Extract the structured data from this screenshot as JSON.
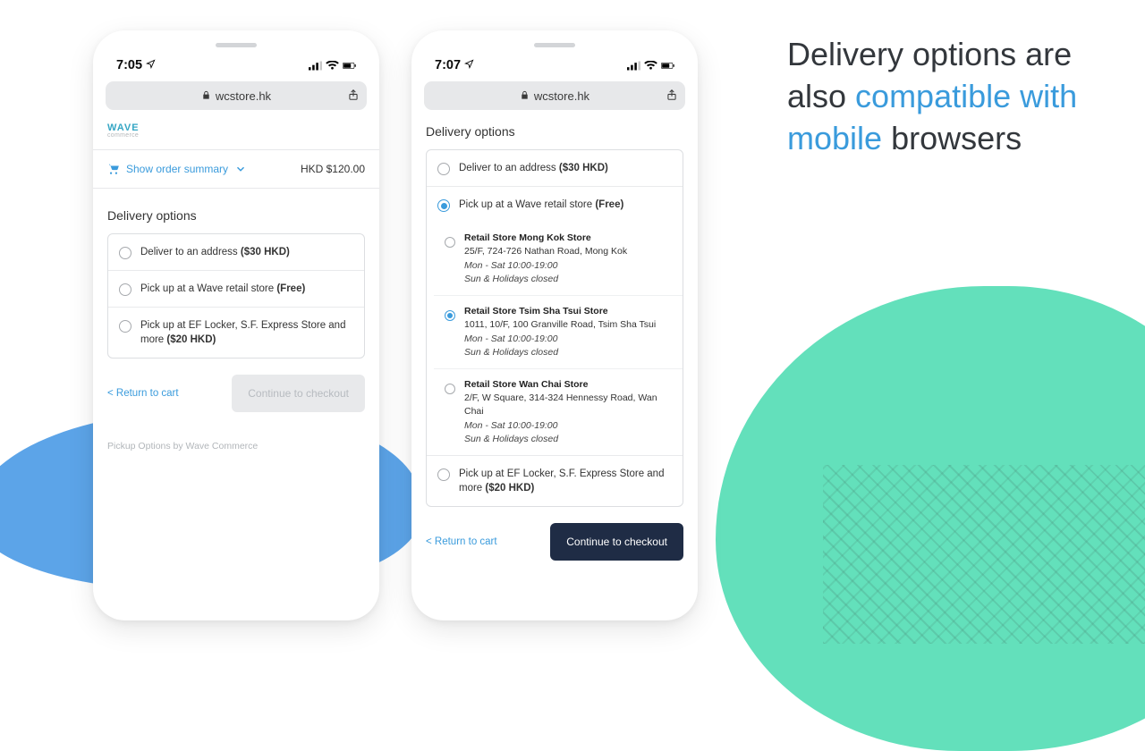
{
  "heading": {
    "part1": "Delivery options are also ",
    "highlight": "compatible with mobile",
    "part2": " browsers"
  },
  "phones": {
    "left": {
      "time": "7:05",
      "url": "wcstore.hk",
      "logo": "WAVE",
      "logo_sub": "commerce",
      "summary_label": "Show order summary",
      "summary_total": "HKD $120.00",
      "section_title": "Delivery options",
      "options": [
        {
          "label": "Deliver to an address ",
          "price": "($30 HKD)"
        },
        {
          "label": "Pick up at a Wave retail store ",
          "price": "(Free)"
        },
        {
          "label": "Pick up at EF Locker, S.F. Express Store and more ",
          "price": "($20 HKD)"
        }
      ],
      "return": "< Return to cart",
      "cta": "Continue to checkout",
      "footer_note": "Pickup Options by Wave Commerce"
    },
    "right": {
      "time": "7:07",
      "url": "wcstore.hk",
      "section_title": "Delivery options",
      "opt_deliver_label": "Deliver to an address ",
      "opt_deliver_price": "($30 HKD)",
      "opt_pickup_label": "Pick up at a Wave retail store ",
      "opt_pickup_price": "(Free)",
      "stores": [
        {
          "name": "Retail Store Mong Kok Store",
          "addr": "25/F, 724-726 Nathan Road, Mong Kok",
          "hours1": "Mon - Sat 10:00-19:00",
          "hours2": "Sun & Holidays closed"
        },
        {
          "name": "Retail Store Tsim Sha Tsui Store",
          "addr": "1011, 10/F, 100 Granville Road, Tsim Sha Tsui",
          "hours1": "Mon - Sat 10:00-19:00",
          "hours2": "Sun & Holidays closed"
        },
        {
          "name": "Retail Store Wan Chai Store",
          "addr": "2/F, W Square, 314-324 Hennessy Road, Wan Chai",
          "hours1": "Mon - Sat 10:00-19:00",
          "hours2": "Sun & Holidays closed"
        }
      ],
      "opt_locker_label": "Pick up at EF Locker, S.F. Express Store and more ",
      "opt_locker_price": "($20 HKD)",
      "return": "< Return to cart",
      "cta": "Continue to checkout"
    }
  }
}
